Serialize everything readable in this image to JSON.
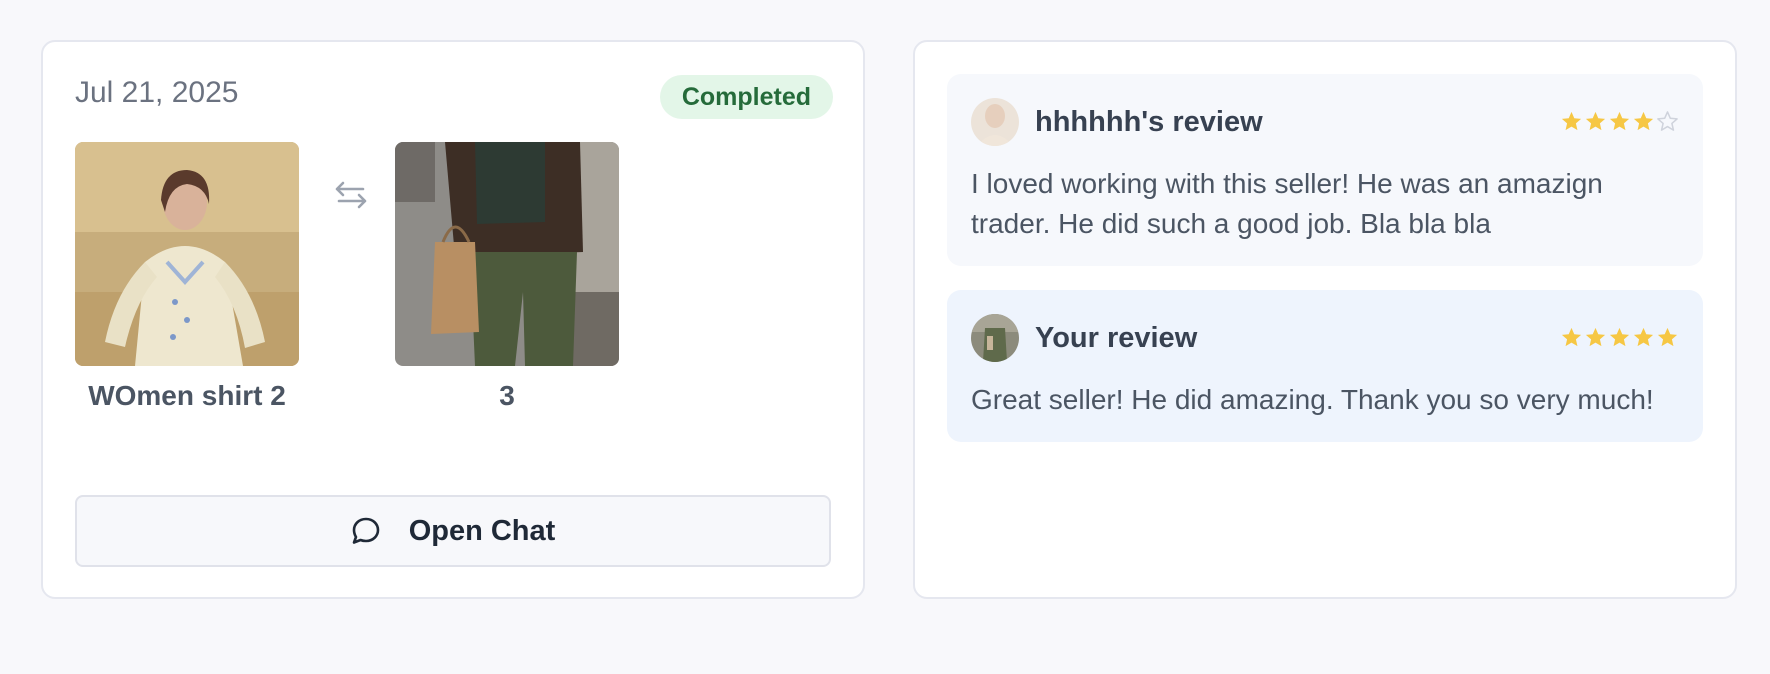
{
  "trade": {
    "date": "Jul 21, 2025",
    "status": "Completed",
    "status_color": "#256b3a",
    "items": [
      {
        "label": "WOmen shirt 2",
        "image": "woman-cream-embroidered-dress-photo"
      },
      {
        "label": "3",
        "image": "brown-jacket-green-pants-street-photo"
      }
    ],
    "swap_icon": "swap-arrows-icon",
    "chat_button": {
      "label": "Open Chat",
      "icon": "chat-bubble-icon"
    }
  },
  "reviews": [
    {
      "title": "hhhhhh's review",
      "rating": 4,
      "max_rating": 5,
      "body": "I loved working with this seller! He was an amazign trader. He did such a good job. Bla bla bla",
      "avatar": "user-avatar"
    },
    {
      "title": "Your review",
      "rating": 5,
      "max_rating": 5,
      "body": "Great seller! He did amazing. Thank you so very much!",
      "avatar": "your-avatar"
    }
  ],
  "colors": {
    "star_filled": "#f6c744",
    "star_empty": "#cfd3dc",
    "review_bg_other": "#f6f8fc",
    "review_bg_mine": "#eef4fd"
  }
}
